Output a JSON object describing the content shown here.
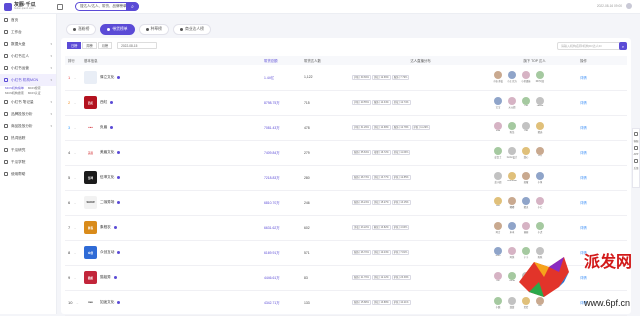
{
  "topbar": {
    "logo_title": "灰豚·千瓜",
    "logo_sub": "huitun.qianh.com",
    "search_value": "搜达人/达人、带货、品牌榜单搜",
    "datetime": "2022-08-16 09:00"
  },
  "sidebar": {
    "items": [
      {
        "label": "首页",
        "active": false
      },
      {
        "label": "工作台",
        "active": false
      },
      {
        "label": "数据大盘",
        "active": false
      },
      {
        "label": "小红书达人",
        "active": false
      },
      {
        "label": "小红书运营",
        "active": false
      },
      {
        "label": "小红书 机构MCN",
        "active": true
      }
    ],
    "sub_items": [
      "MCN机构榜单",
      "MCN搜索",
      "MCN机构搜索",
      "MCN认证"
    ],
    "more_items": [
      {
        "label": "小红书 笔记量"
      },
      {
        "label": "品牌投放分析"
      },
      {
        "label": "商品投放分析"
      },
      {
        "label": "热词追踪"
      },
      {
        "label": "千瓜研究"
      },
      {
        "label": "千瓜学院"
      },
      {
        "label": "使用帮助"
      }
    ]
  },
  "tabs": [
    {
      "label": "涨粉榜",
      "active": false
    },
    {
      "label": "带货榜单",
      "active": true
    },
    {
      "label": "种草榜",
      "active": false
    },
    {
      "label": "商业达人榜",
      "active": false
    }
  ],
  "filters": {
    "options": [
      "日榜",
      "周榜",
      "月榜"
    ],
    "active": "日榜",
    "date": "2022-08-15",
    "search_placeholder": "请输入机构名称/机构ID/达人ID"
  },
  "table": {
    "headers": [
      "排行",
      "基本信息",
      "带货总额",
      "带货达人数",
      "达人直播分布",
      "旗下 TOP 达人",
      "操作"
    ],
    "rows": [
      {
        "rank": "1",
        "name": "驿立文化",
        "logo_color": "#ffffff",
        "logo_text": "",
        "logo_bg": "#e9eef6",
        "gmv": "1.44亿",
        "count": "1,122",
        "tags": [
          "护肤 | 30.69%",
          "美妆 | 12.66%",
          "服饰 | 7.79%"
        ],
        "avatars": [
          "小张·美妆",
          "小王 官方",
          "小美姐妹",
          "DIY时尚"
        ],
        "action": "详情"
      },
      {
        "rank": "2",
        "name": "西虹",
        "logo_color": "#ffffff",
        "logo_text": "西虹",
        "logo_bg": "#b3121f",
        "gmv": "8798.75万",
        "count": "715",
        "tags": [
          "护肤 | 20.55%",
          "服饰 | 14.34%",
          "美妆 | 12.74%"
        ],
        "avatars": [
          "宝宝",
          "元元姐",
          "Hia",
          "Jessie"
        ],
        "action": "详情"
      },
      {
        "rank": "3",
        "name": "负眉",
        "logo_color": "#d0262f",
        "logo_text": "●●●",
        "logo_bg": "#ffffff",
        "gmv": "7081.43万",
        "count": "478",
        "tags": [
          "护肤 | 31.29%",
          "美妆 | 14.68%",
          "服饰 | 12.78%",
          "护肤 | 11.29%"
        ],
        "avatars": [
          "Lulu",
          "陈浩",
          "Ytar",
          "精选"
        ],
        "action": "详情"
      },
      {
        "rank": "4",
        "name": "美眉文化",
        "logo_color": "#e06e70",
        "logo_text": "美眉",
        "logo_bg": "#ffffff",
        "gmv": "7409.84万",
        "count": "279",
        "tags": [
          "服饰 | 35.84%",
          "母婴 | 16.72%",
          "美妆 | 11.63%"
        ],
        "avatars": [
          "彭女士",
          "CoCo设计",
          "甜心",
          "Lily"
        ],
        "action": "详情"
      },
      {
        "rank": "5",
        "name": "伍坤文化",
        "logo_color": "#ffffff",
        "logo_text": "伍坤",
        "logo_bg": "#1b1b1b",
        "gmv": "7218.83万",
        "count": "280",
        "tags": [
          "服饰 | 28.73%",
          "美妆 | 13.77%",
          "护肤 | 12.85%"
        ],
        "avatars": [
          "蓝小姐",
          "Anshoule",
          "闺蜜",
          "小鱼"
        ],
        "action": "详情"
      },
      {
        "rank": "6",
        "name": "二咖秀场",
        "logo_color": "#333333",
        "logo_text": "SHOW",
        "logo_bg": "#f2f2f2",
        "gmv": "6810.70万",
        "count": "246",
        "tags": [
          "服饰 | 46.24%",
          "美妆 | 15.27%",
          "护肤 | 13.15%"
        ],
        "avatars": [
          "Leo",
          "嘟嘟",
          "精灵",
          "小七"
        ],
        "action": "详情"
      },
      {
        "rank": "7",
        "name": "象程农",
        "logo_color": "#ffffff",
        "logo_text": "象程",
        "logo_bg": "#d98b1a",
        "gmv": "6631.62万",
        "count": "602",
        "tags": [
          "美妆 | 23.22%",
          "家居 | 13.82%",
          "护肤 | 4.63%"
        ],
        "avatars": [
          "阿言",
          "木木",
          "丽丽",
          "小虎"
        ],
        "action": "详情"
      },
      {
        "rank": "8",
        "name": "众创互动",
        "logo_color": "#ffffff",
        "logo_text": "众创",
        "logo_bg": "#2f6bd6",
        "gmv": "6169.91万",
        "count": "571",
        "tags": [
          "服饰 | 26.70%",
          "美妆 | 10.43%",
          "护肤 | 7.81%"
        ],
        "avatars": [
          "sihui",
          "阿然",
          "宁宁",
          "陈陈"
        ],
        "action": "详情"
      },
      {
        "rank": "9",
        "name": "猫姐秀",
        "logo_color": "#ffffff",
        "logo_text": "猫姐",
        "logo_bg": "#c2253a",
        "gmv": "4446.61万",
        "count": "83",
        "tags": [
          "服饰 | 21.76%",
          "美妆 | 12.12%",
          "护肤 | 23.39%"
        ],
        "avatars": [
          "Yeh",
          "Anna",
          "晨曦",
          "苗苗"
        ],
        "action": "详情"
      },
      {
        "rank": "10",
        "name": "如途文化",
        "logo_color": "#222222",
        "logo_text": "nuo",
        "logo_bg": "#ffffff",
        "gmv": "4342.71万",
        "count": "133",
        "tags": [
          "服饰 | 15.88%",
          "美妆 | 13.88%",
          "护肤 | 10.21%"
        ],
        "avatars": [
          "小鹿",
          "甜甜",
          "若若",
          "Kiki"
        ],
        "action": "详情"
      }
    ]
  },
  "right_rail": {
    "items": [
      "客服",
      "APP",
      "反馈"
    ]
  },
  "watermark": {
    "text": "派发网",
    "url": "www.6pf.cn"
  }
}
